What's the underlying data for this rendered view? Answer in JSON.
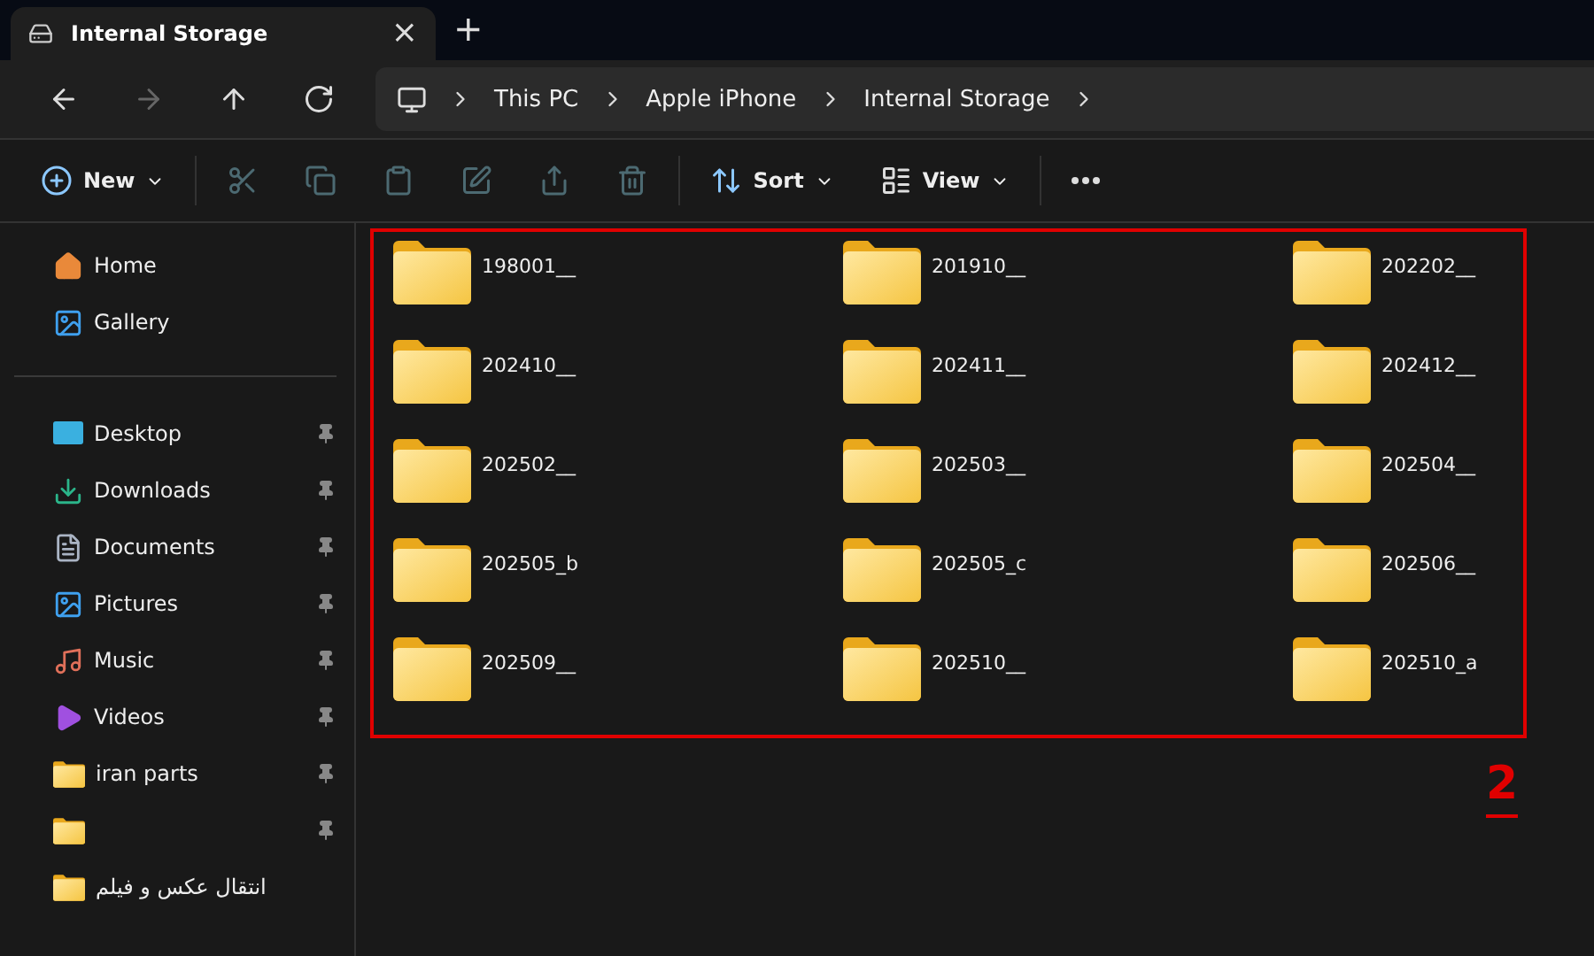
{
  "tab": {
    "title": "Internal Storage",
    "close": "×",
    "new": "+"
  },
  "nav": [
    {
      "kind": "back",
      "disabled": false
    },
    {
      "kind": "forward",
      "disabled": true
    },
    {
      "kind": "up",
      "disabled": false
    },
    {
      "kind": "refresh",
      "disabled": false
    }
  ],
  "breadcrumb": [
    "This PC",
    "Apple iPhone",
    "Internal Storage"
  ],
  "toolbar": [
    {
      "kind": "new",
      "label": "New",
      "disabled": false
    },
    {
      "kind": "cut",
      "disabled": true
    },
    {
      "kind": "copy",
      "disabled": true
    },
    {
      "kind": "paste",
      "disabled": true
    },
    {
      "kind": "rename",
      "disabled": true
    },
    {
      "kind": "share",
      "disabled": true
    },
    {
      "kind": "delete",
      "disabled": true
    },
    {
      "kind": "sort",
      "label": "Sort",
      "disabled": false
    },
    {
      "kind": "view",
      "label": "View",
      "disabled": false
    },
    {
      "kind": "more",
      "disabled": false
    }
  ],
  "sidebar": {
    "top": [
      {
        "kind": "home",
        "label": "Home"
      },
      {
        "kind": "gallery",
        "label": "Gallery"
      }
    ],
    "quick": [
      {
        "kind": "desktop",
        "label": "Desktop",
        "pinned": true
      },
      {
        "kind": "download",
        "label": "Downloads",
        "pinned": true
      },
      {
        "kind": "document",
        "label": "Documents",
        "pinned": true
      },
      {
        "kind": "pictures",
        "label": "Pictures",
        "pinned": true
      },
      {
        "kind": "music",
        "label": "Music",
        "pinned": true
      },
      {
        "kind": "videos",
        "label": "Videos",
        "pinned": true
      },
      {
        "kind": "folder",
        "label": "iran parts",
        "pinned": true
      },
      {
        "kind": "folder",
        "pinned": true
      },
      {
        "kind": "folder",
        "label": "انتقال عکس و فیلم",
        "pinned": false
      }
    ]
  },
  "folders": [
    "198001__",
    "201910__",
    "202202__",
    "202410__",
    "202411__",
    "202412__",
    "202502__",
    "202503__",
    "202504__",
    "202505_b",
    "202505_c",
    "202506__",
    "202509__",
    "202510__",
    "202510_a"
  ],
  "annotation": {
    "step": "2"
  }
}
